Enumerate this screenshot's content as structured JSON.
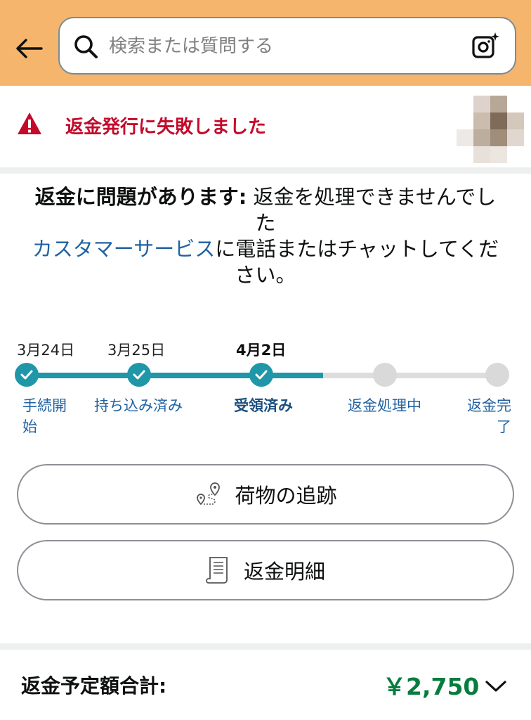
{
  "header": {
    "search_placeholder": "検索または質問する",
    "icons": [
      "back-arrow-icon",
      "search-icon",
      "camera-icon"
    ]
  },
  "alert": {
    "text": "返金発行に失敗しました",
    "icon": "warning-triangle-icon",
    "color": "#c40a2b"
  },
  "message": {
    "bold_prefix": "返金に問題があります:",
    "line1_rest": " 返金を処理できませんでした",
    "link_text": "カスタマーサービス",
    "line2_rest": "に電話またはチャットしてください。"
  },
  "timeline": {
    "dates": [
      "3月24日",
      "3月25日",
      "4月2日"
    ],
    "steps": [
      {
        "label": "手続開始",
        "done": true
      },
      {
        "label": "持ち込み済み",
        "done": true
      },
      {
        "label": "受領済み",
        "done": true,
        "current": true
      },
      {
        "label": "返金処理中",
        "done": false
      },
      {
        "label": "返金完了",
        "done": false
      }
    ],
    "accent_color": "#1f97a8"
  },
  "buttons": {
    "track_label": "荷物の追跡",
    "details_label": "返金明細"
  },
  "total": {
    "label": "返金予定額合計:",
    "amount": "￥2,750",
    "amount_color": "#067d3e"
  }
}
